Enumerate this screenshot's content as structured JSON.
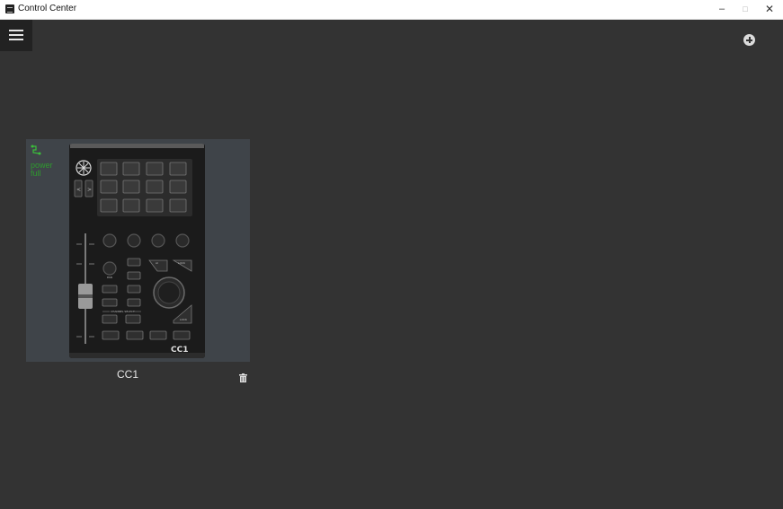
{
  "window": {
    "title": "Control Center"
  },
  "toolbar": {
    "menu_icon": "hamburger-icon",
    "add_icon": "plus-circle-icon"
  },
  "device_card": {
    "status_lines": [
      "power",
      "full"
    ],
    "name": "CC1",
    "device_logo": "CC1",
    "device_label": "CHANNEL SELECT",
    "button_labels": [
      "AI",
      "LOCK",
      "PAN",
      "LOCK"
    ],
    "link_icon": "link-icon",
    "delete_icon": "trash-icon"
  },
  "colors": {
    "background": "#333333",
    "card": "#3f4449",
    "status": "#2e9a2e"
  }
}
